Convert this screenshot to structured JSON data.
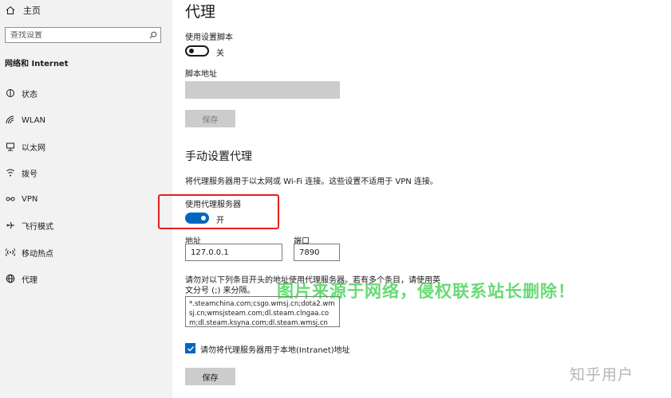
{
  "sidebar": {
    "home_label": "主页",
    "search_placeholder": "查找设置",
    "section_title": "网络和 Internet",
    "items": [
      {
        "label": "状态",
        "icon": "status-icon"
      },
      {
        "label": "WLAN",
        "icon": "wifi-icon"
      },
      {
        "label": "以太网",
        "icon": "ethernet-icon"
      },
      {
        "label": "拨号",
        "icon": "dialup-icon"
      },
      {
        "label": "VPN",
        "icon": "vpn-icon"
      },
      {
        "label": "飞行模式",
        "icon": "airplane-icon"
      },
      {
        "label": "移动热点",
        "icon": "hotspot-icon"
      },
      {
        "label": "代理",
        "icon": "globe-icon"
      }
    ]
  },
  "main": {
    "title": "代理",
    "auto": {
      "script_toggle_label": "使用设置脚本",
      "script_toggle_state": "关",
      "script_address_label": "脚本地址",
      "script_address_value": "",
      "save_label": "保存"
    },
    "manual": {
      "title": "手动设置代理",
      "description": "将代理服务器用于以太网或 Wi-Fi 连接。这些设置不适用于 VPN 连接。",
      "use_proxy_label": "使用代理服务器",
      "use_proxy_state": "开",
      "address_label": "地址",
      "address_value": "127.0.0.1",
      "port_label": "端口",
      "port_value": "7890",
      "exceptions_help_line1": "请勿对以下列条目开头的地址使用代理服务器。若有多个条目，请使用英",
      "exceptions_help_line2": "文分号 (;) 来分隔。",
      "exceptions_value": "*.steamchina.com;csgo.wmsj.cn;dota2.wmsj.cn;wmsjsteam.com;dl.steam.clngaa.com;dl.steam.ksyna.com;dl.steam.wmsj.cn",
      "local_checkbox_label": "请勿将代理服务器用于本地(Intranet)地址",
      "local_checkbox_checked": true,
      "save_label": "保存"
    }
  },
  "overlay": {
    "watermark_text": "图片来源于网络，侵权联系站长删除！",
    "zhihu_text": "知乎用户"
  },
  "colors": {
    "accent": "#0067c0",
    "highlight": "#e02020",
    "watermark": "#2ecc40"
  }
}
